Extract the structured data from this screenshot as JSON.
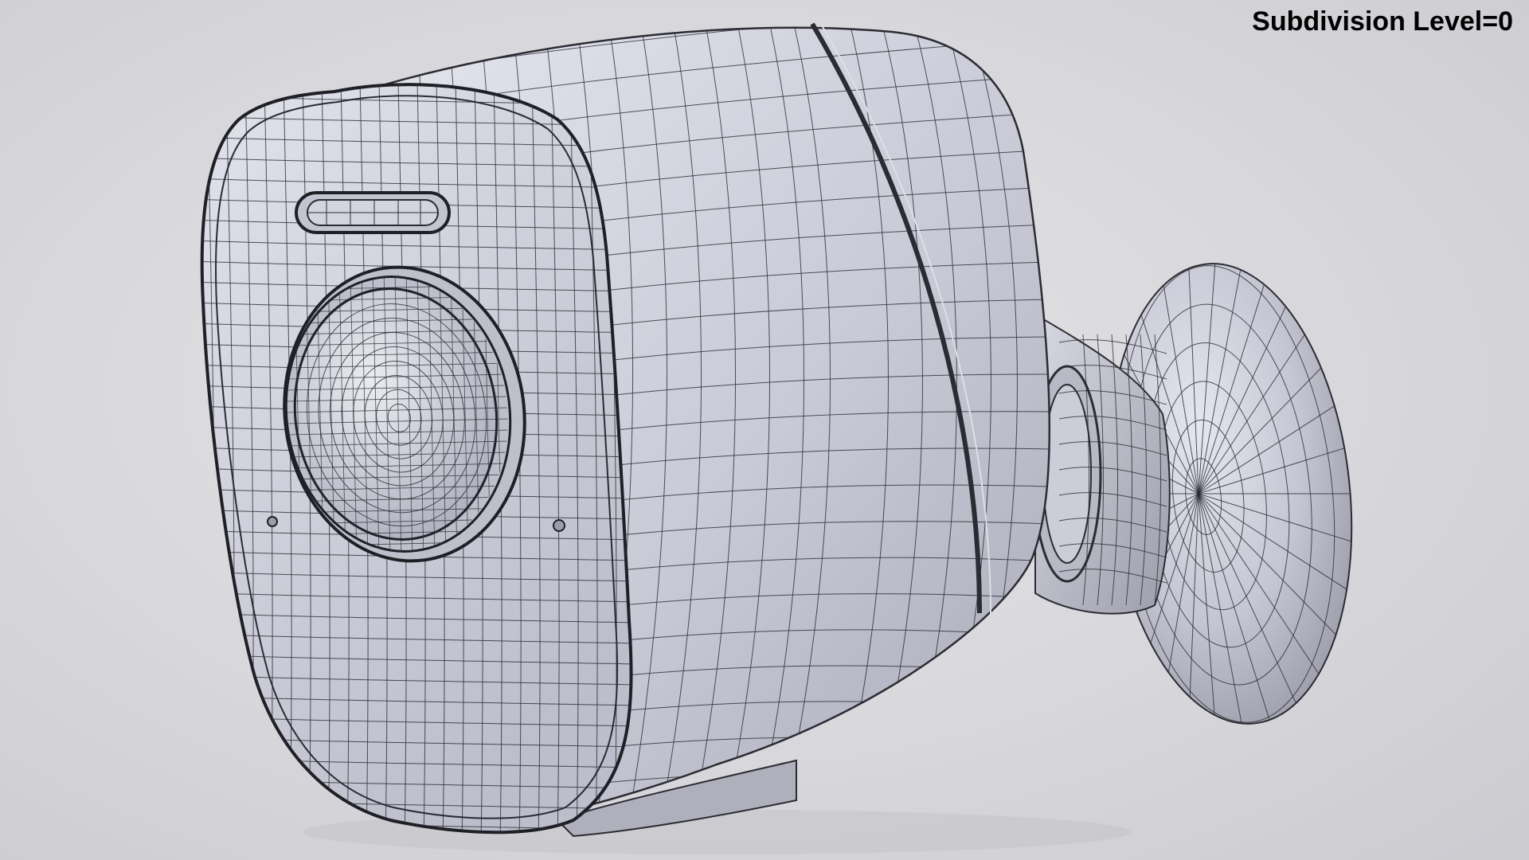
{
  "viewport": {
    "overlay_text": "Subdivision Level=0"
  },
  "model": {
    "subject": "security camera with wall mount",
    "render_style": "wireframe over shaded",
    "colors": {
      "background": "#d9d9dd",
      "surface": "#c9c9d6",
      "surface_light": "#e3e3ec",
      "surface_shadow": "#a5a5b2",
      "wire": "#2b2b33",
      "overlay_text": "#000000"
    }
  }
}
